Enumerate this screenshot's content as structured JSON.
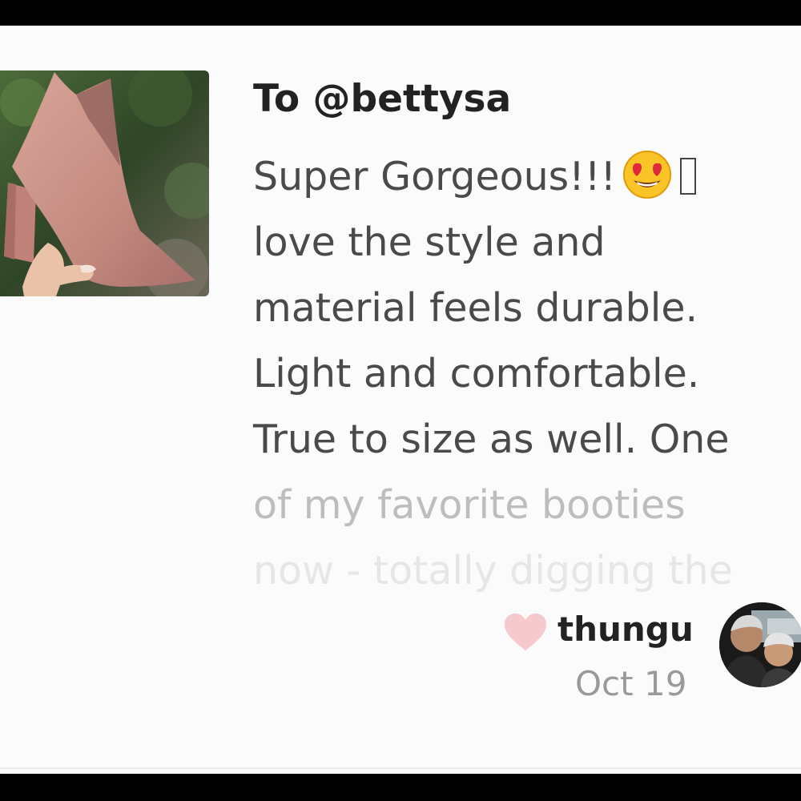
{
  "review": {
    "recipient": "To @bettysa",
    "lines": [
      "Super Gorgeous!!!",
      "love the style and",
      "material feels durable.",
      "Light and comfortable.",
      "True to size as well. One",
      "of my favorite booties",
      "now - totally digging the"
    ],
    "emoji": "heart-eyes-emoji"
  },
  "product_image": {
    "subject": "pink-ankle-bootie-photo"
  },
  "author": {
    "username": "thungu",
    "date": "Oct 19",
    "like_icon": "heart-icon",
    "like_color": "#f6c9cd"
  }
}
